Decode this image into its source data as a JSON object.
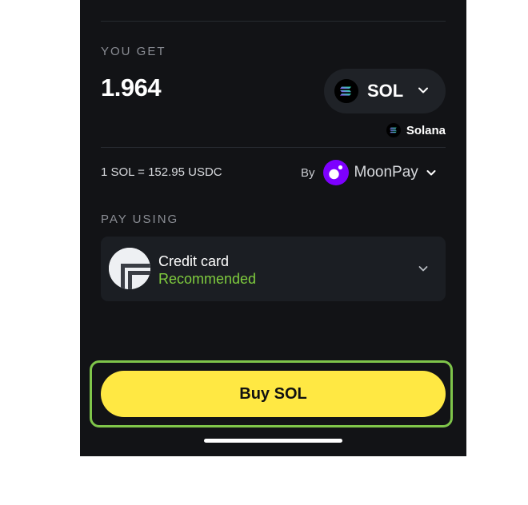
{
  "receive": {
    "section_label": "YOU GET",
    "amount": "1.964",
    "token": "SOL",
    "token_icon": "solana-logo-icon",
    "network": "Solana",
    "network_icon": "solana-logo-icon"
  },
  "quote": {
    "rate": "1 SOL = 152.95 USDC",
    "provider_prefix": "By",
    "provider": "MoonPay",
    "provider_icon": "moonpay-logo-icon",
    "provider_color": "#7d00ff"
  },
  "payment": {
    "section_label": "PAY USING",
    "method": "Credit card",
    "badge": "Recommended",
    "badge_color": "#7fcc3e",
    "method_icon": "credit-card-provider-icon"
  },
  "cta": {
    "label": "Buy SOL",
    "color": "#ffe843",
    "highlight_color": "#7fc54a"
  },
  "theme": {
    "background": "#121316",
    "surface": "#1b1e23"
  }
}
